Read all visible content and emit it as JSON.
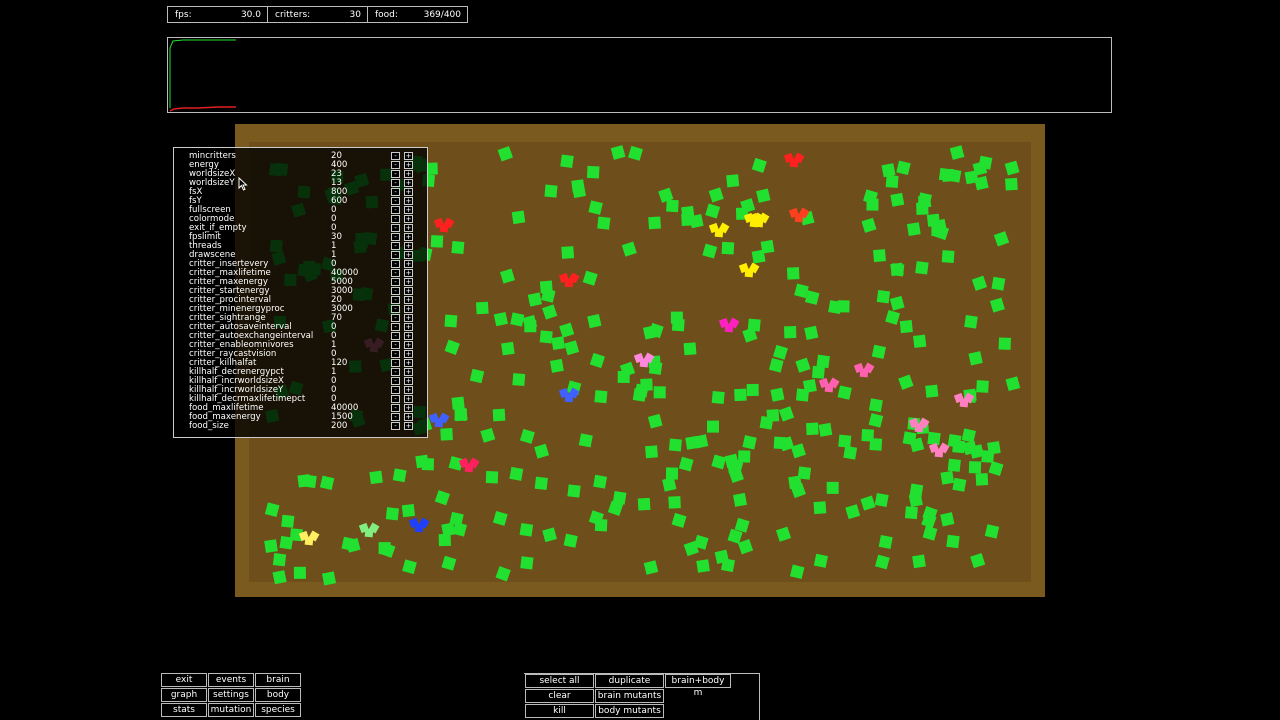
{
  "stats": {
    "fps_label": "fps:",
    "fps_value": "30.0",
    "critters_label": "critters:",
    "critters_value": "30",
    "food_label": "food:",
    "food_value": "369/400"
  },
  "settings": [
    {
      "key": "mincritters",
      "value": "20"
    },
    {
      "key": "energy",
      "value": "400"
    },
    {
      "key": "worldsizeX",
      "value": "23"
    },
    {
      "key": "worldsizeY",
      "value": "13"
    },
    {
      "key": "fsX",
      "value": "800"
    },
    {
      "key": "fsY",
      "value": "600"
    },
    {
      "key": "fullscreen",
      "value": "0"
    },
    {
      "key": "colormode",
      "value": "0"
    },
    {
      "key": "exit_if_empty",
      "value": "0"
    },
    {
      "key": "fpslimit",
      "value": "30"
    },
    {
      "key": "threads",
      "value": "1"
    },
    {
      "key": "drawscene",
      "value": "1"
    },
    {
      "key": "critter_insertevery",
      "value": "0"
    },
    {
      "key": "critter_maxlifetime",
      "value": "40000"
    },
    {
      "key": "critter_maxenergy",
      "value": "5000"
    },
    {
      "key": "critter_startenergy",
      "value": "3000"
    },
    {
      "key": "critter_procinterval",
      "value": "20"
    },
    {
      "key": "critter_minenergyproc",
      "value": "3000"
    },
    {
      "key": "critter_sightrange",
      "value": "70"
    },
    {
      "key": "critter_autosaveinterval",
      "value": "0"
    },
    {
      "key": "critter_autoexchangeinterval",
      "value": "0"
    },
    {
      "key": "critter_enableomnivores",
      "value": "1"
    },
    {
      "key": "critter_raycastvision",
      "value": "0"
    },
    {
      "key": "critter_killhalfat",
      "value": "120"
    },
    {
      "key": "killhalf_decrenergypct",
      "value": "1"
    },
    {
      "key": "killhalf_incrworldsizeX",
      "value": "0"
    },
    {
      "key": "killhalf_incrworldsizeY",
      "value": "0"
    },
    {
      "key": "killhalf_decrmaxlifetimepct",
      "value": "0"
    },
    {
      "key": "food_maxlifetime",
      "value": "40000"
    },
    {
      "key": "food_maxenergy",
      "value": "1500"
    },
    {
      "key": "food_size",
      "value": "200"
    }
  ],
  "setting_buttons": {
    "minus": "-",
    "plus": "+"
  },
  "menu_left": [
    [
      "exit",
      "events",
      "brain"
    ],
    [
      "graph",
      "settings",
      "body"
    ],
    [
      "stats",
      "mutation",
      "species"
    ]
  ],
  "menu_right": [
    [
      "select all",
      "duplicate",
      "brain+body m"
    ],
    [
      "clear",
      "brain mutants"
    ],
    [
      "kill",
      "body mutants"
    ]
  ],
  "colors": {
    "world_border": "#7a5a1e",
    "world_floor": "#6e4e1a",
    "food": "#22e030",
    "graph_food_line": "#22e030",
    "graph_critter_line": "#e02020"
  }
}
